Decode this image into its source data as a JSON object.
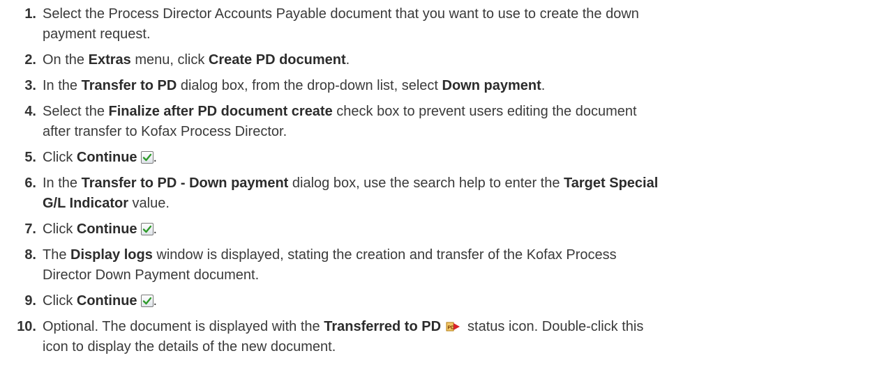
{
  "steps": [
    {
      "num": "1.",
      "t1": "Select the Process Director Accounts Payable document that you want to use to create the down",
      "t2": "payment request."
    },
    {
      "num": "2.",
      "a": "On the ",
      "b1": "Extras",
      "c": " menu, click ",
      "b2": "Create PD document",
      "d": "."
    },
    {
      "num": "3.",
      "a": "In the ",
      "b1": "Transfer to PD",
      "c": " dialog box, from the drop-down list, select ",
      "b2": "Down payment",
      "d": "."
    },
    {
      "num": "4.",
      "a": "Select the ",
      "b1": "Finalize after PD document create",
      "c": " check box to prevent users editing the document",
      "t2": "after transfer to Kofax Process Director."
    },
    {
      "num": "5.",
      "a": "Click ",
      "b1": "Continue",
      "icon": "continue-checkmark-icon",
      "d": "."
    },
    {
      "num": "6.",
      "a": "In the ",
      "b1": "Transfer to PD - Down payment",
      "c": " dialog box, use the search help to enter the ",
      "b2": "Target Special",
      "b3": "G/L Indicator",
      "e": " value."
    },
    {
      "num": "7.",
      "a": "Click ",
      "b1": "Continue",
      "icon": "continue-checkmark-icon",
      "d": "."
    },
    {
      "num": "8.",
      "a": "The ",
      "b1": "Display logs",
      "c": " window is displayed, stating the creation and transfer of the Kofax Process",
      "t2": "Director Down Payment document."
    },
    {
      "num": "9.",
      "a": "Click ",
      "b1": "Continue",
      "icon": "continue-checkmark-icon",
      "d": "."
    },
    {
      "num": "10.",
      "a": "Optional. The document is displayed with the ",
      "b1": "Transferred to PD",
      "icon": "transferred-to-pd-status-icon",
      "c": "status icon. Double-click this",
      "t2": "icon to display the details of the new document."
    }
  ],
  "colors": {
    "text": "#3a3a3a",
    "check_green": "#2e9a2a"
  }
}
